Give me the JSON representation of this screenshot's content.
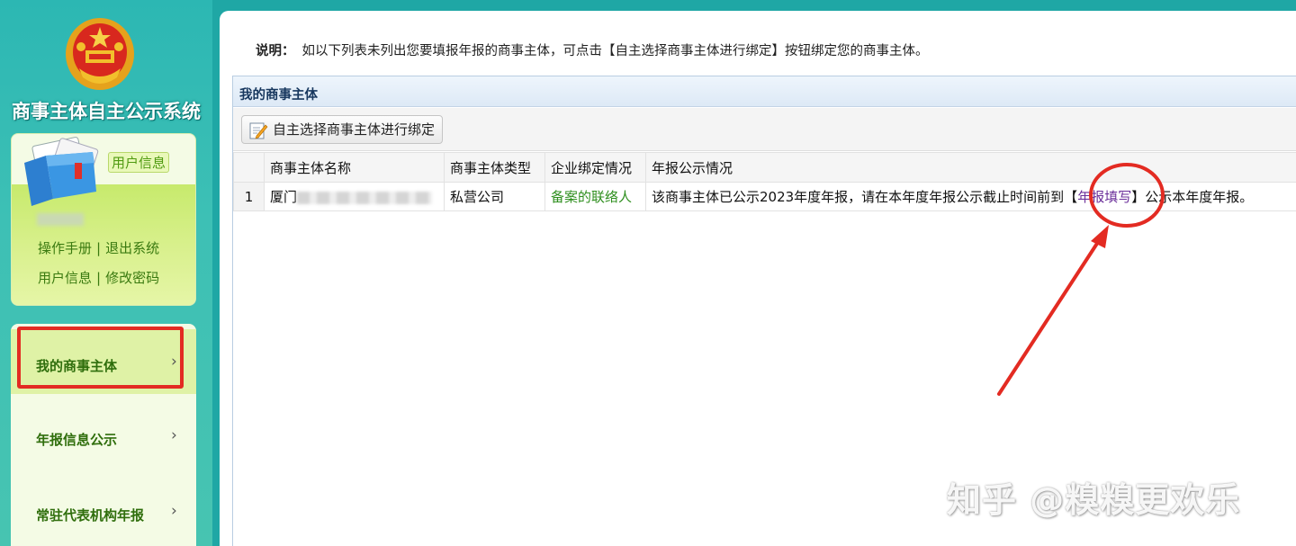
{
  "sidebar": {
    "system_title": "商事主体自主公示系统",
    "user_info_tag": "用户信息",
    "links": {
      "manual": "操作手册",
      "logout": "退出系统",
      "user_info": "用户信息",
      "change_password": "修改密码",
      "separator": "|"
    },
    "menu": [
      {
        "label": "我的商事主体",
        "chevron": "›"
      },
      {
        "label": "年报信息公示",
        "chevron": "›"
      },
      {
        "label": "常驻代表机构年报",
        "chevron": "›"
      }
    ]
  },
  "main": {
    "note_label": "说明：",
    "note_text": "如以下列表未列出您要填报年报的商事主体，可点击【自主选择商事主体进行绑定】按钮绑定您的商事主体。",
    "section_title": "我的商事主体",
    "bind_button_label": "自主选择商事主体进行绑定",
    "table": {
      "headers": [
        "",
        "商事主体名称",
        "商事主体类型",
        "企业绑定情况",
        "年报公示情况"
      ],
      "rows": [
        {
          "num": "1",
          "name": "厦门",
          "type": "私营公司",
          "binding": "备案的联络人",
          "status_pre": "该商事主体已公示2023年度年报，请在本年度年报公示截止时间前到【",
          "status_link": "年报填写",
          "status_post": "】公示本年度年报。"
        }
      ]
    }
  },
  "watermark": "知乎 @糗糗更欢乐",
  "colors": {
    "accent_teal": "#1fa7a5",
    "menu_green": "#2f6e0c",
    "annotation_red": "#e32b22",
    "link_purple": "#6b2f9a"
  }
}
